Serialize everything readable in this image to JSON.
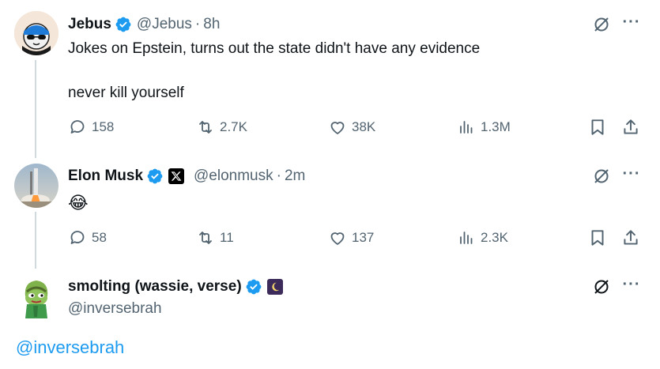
{
  "tweets": [
    {
      "name": "Jebus",
      "handle": "@Jebus",
      "time": "8h",
      "line1": "Jokes on Epstein, turns out the state didn't have any evidence",
      "line2": "never kill yourself",
      "replies": "158",
      "retweets": "2.7K",
      "likes": "38K",
      "views": "1.3M"
    },
    {
      "name": "Elon Musk",
      "handle": "@elonmusk",
      "time": "2m",
      "emoji": "😂",
      "replies": "58",
      "retweets": "11",
      "likes": "137",
      "views": "2.3K"
    },
    {
      "name": "smolting (wassie, verse)",
      "handle": "@inversebrah"
    }
  ],
  "reply_link": "@inversebrah",
  "colors": {
    "accent": "#1d9bf0",
    "muted": "#536471",
    "text": "#0f1419"
  }
}
